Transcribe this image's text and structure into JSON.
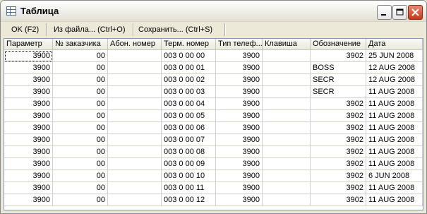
{
  "window": {
    "title": "Таблица"
  },
  "toolbar": {
    "ok_label": "OK (F2)",
    "from_file_label": "Из файла... (Ctrl+O)",
    "save_label": "Сохранить... (Ctrl+S)"
  },
  "columns": [
    "Параметр",
    "№ заказчика",
    "Абон. номер",
    "Терм. номер",
    "Тип телеф...",
    "Клавиша",
    "Обозначение",
    "Дата"
  ],
  "rows": [
    [
      "3900",
      "00",
      "",
      "003 0 00 00",
      "3900",
      "",
      "3902",
      "25 JUN 2008"
    ],
    [
      "3900",
      "00",
      "",
      "003 0 00 01",
      "3900",
      "",
      "BOSS",
      "12 AUG 2008"
    ],
    [
      "3900",
      "00",
      "",
      "003 0 00 02",
      "3900",
      "",
      "SECR",
      "12 AUG 2008"
    ],
    [
      "3900",
      "00",
      "",
      "003 0 00 03",
      "3900",
      "",
      "SECR",
      "11 AUG 2008"
    ],
    [
      "3900",
      "00",
      "",
      "003 0 00 04",
      "3900",
      "",
      "3902",
      "11 AUG 2008"
    ],
    [
      "3900",
      "00",
      "",
      "003 0 00 05",
      "3900",
      "",
      "3902",
      "11 AUG 2008"
    ],
    [
      "3900",
      "00",
      "",
      "003 0 00 06",
      "3900",
      "",
      "3902",
      "11 AUG 2008"
    ],
    [
      "3900",
      "00",
      "",
      "003 0 00 07",
      "3900",
      "",
      "3902",
      "11 AUG 2008"
    ],
    [
      "3900",
      "00",
      "",
      "003 0 00 08",
      "3900",
      "",
      "3902",
      "11 AUG 2008"
    ],
    [
      "3900",
      "00",
      "",
      "003 0 00 09",
      "3900",
      "",
      "3902",
      "11 AUG 2008"
    ],
    [
      "3900",
      "00",
      "",
      "003 0 00 10",
      "3900",
      "",
      "3902",
      " 6 JUN 2008"
    ],
    [
      "3900",
      "00",
      "",
      "003 0 00 11",
      "3900",
      "",
      "3902",
      "11 AUG 2008"
    ],
    [
      "3900",
      "00",
      "",
      "003 0 00 12",
      "3900",
      "",
      "3902",
      "11 AUG 2008"
    ]
  ]
}
